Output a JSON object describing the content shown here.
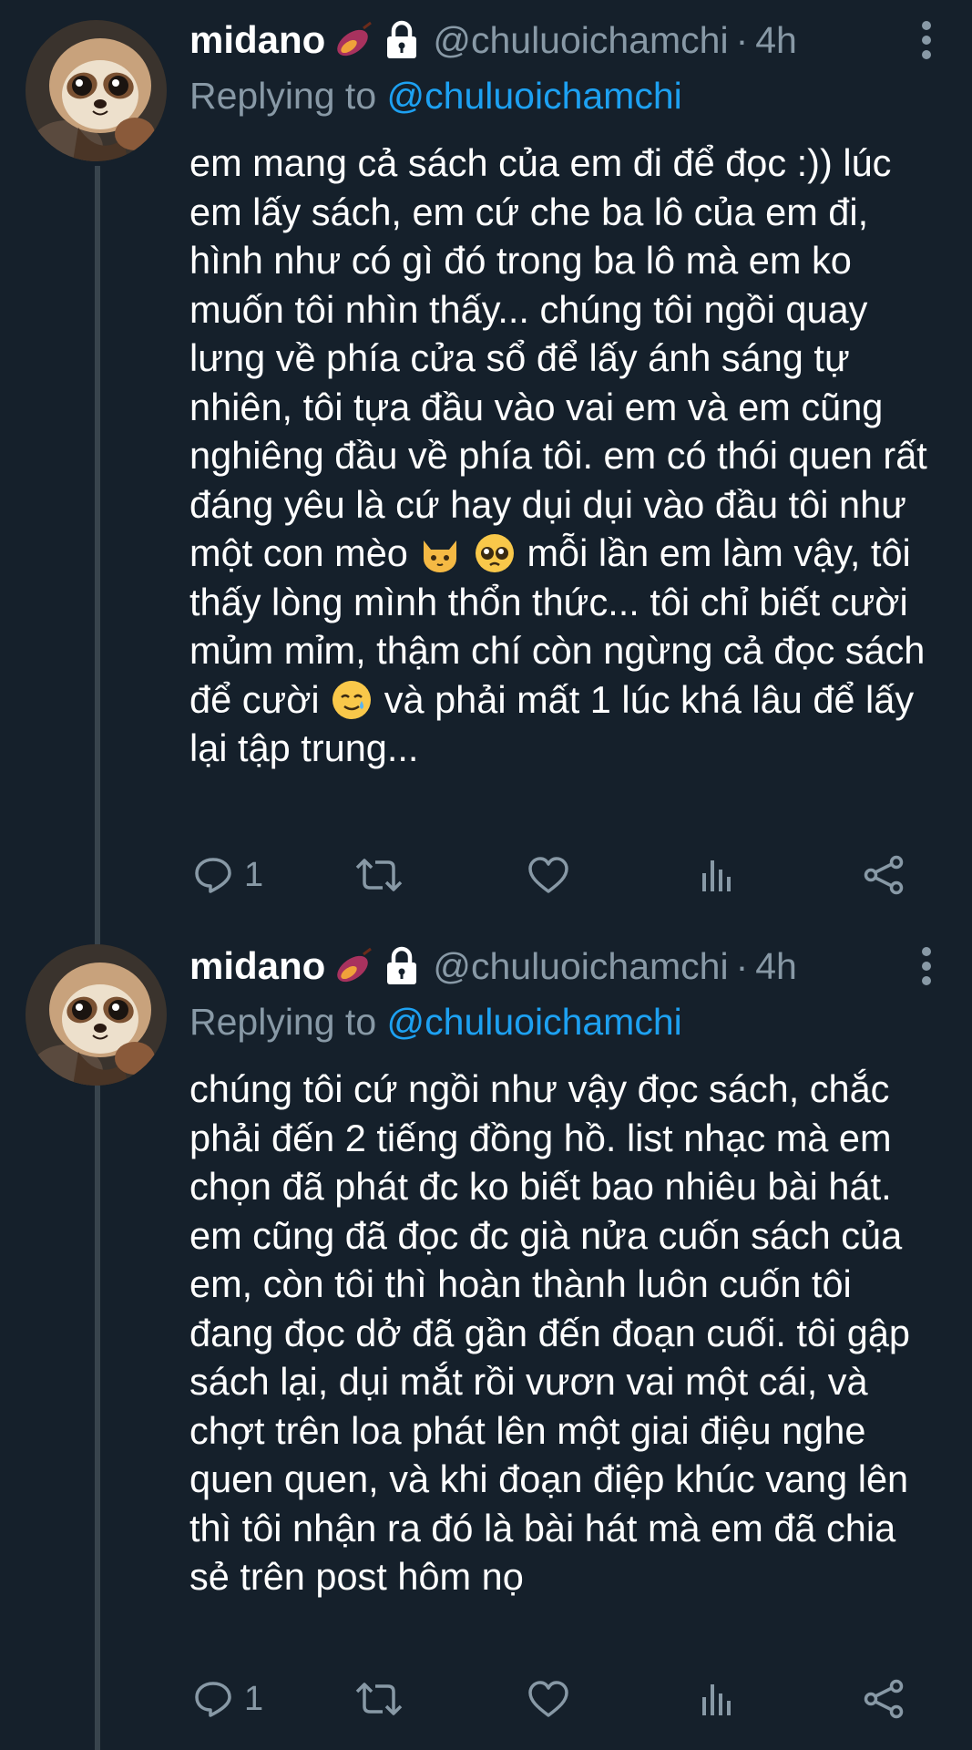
{
  "tweets": [
    {
      "display_name": "midano",
      "name_emoji": "sweet-potato-emoji",
      "handle": "@chuluoichamchi",
      "separator": "·",
      "time": "4h",
      "replying_prefix": "Replying to",
      "replying_to": "@chuluoichamchi",
      "text_parts": [
        "em mang cả sách của em đi để đọc :)) lúc em lấy sách, em cứ che ba lô của em đi, hình như có gì đó trong ba lô mà em ko muốn tôi nhìn thấy... chúng tôi ngồi quay lưng về phía cửa sổ để lấy ánh sáng tự nhiên, tôi tựa đầu vào vai em và em cũng nghiêng đầu về phía tôi. em có thói quen rất đáng yêu là cứ hay dụi dụi vào đầu tôi như một con mèo",
        "mỗi lần em làm vậy, tôi thấy lòng mình thổn thức... tôi chỉ biết cười mủm mỉm, thậm chí còn ngừng cả đọc sách để cười",
        "và phải mất 1 lúc khá lâu để lấy lại tập trung..."
      ],
      "reply_count": "1"
    },
    {
      "display_name": "midano",
      "name_emoji": "sweet-potato-emoji",
      "handle": "@chuluoichamchi",
      "separator": "·",
      "time": "4h",
      "replying_prefix": "Replying to",
      "replying_to": "@chuluoichamchi",
      "text": "chúng tôi cứ ngồi như vậy đọc sách, chắc phải đến 2 tiếng đồng hồ. list nhạc mà em chọn đã phát đc ko biết bao nhiêu bài hát. em cũng đã đọc đc già nửa cuốn sách của em, còn tôi thì hoàn thành luôn cuốn tôi đang đọc dở đã gần đến đoạn cuối. tôi gập sách lại, dụi mắt rồi vươn vai một cái, và chợt trên loa phát lên một giai điệu nghe quen quen, và khi đoạn điệp khúc vang lên thì tôi nhận ra đó là bài hát mà em đã chia sẻ trên post hôm nọ",
      "reply_count": "1"
    }
  ],
  "icons": {
    "inline_emojis_1": [
      "cat-emoji",
      "pleading-face-emoji"
    ],
    "inline_emojis_2": [
      "smiling-face-with-tear-emoji"
    ],
    "actions": [
      "reply-icon",
      "retweet-icon",
      "like-icon",
      "analytics-icon",
      "share-icon"
    ]
  },
  "colors": {
    "background": "#15202b",
    "text": "#ffffff",
    "secondary": "#8899a6",
    "link": "#1da1f2",
    "thread_line": "#38444d"
  }
}
